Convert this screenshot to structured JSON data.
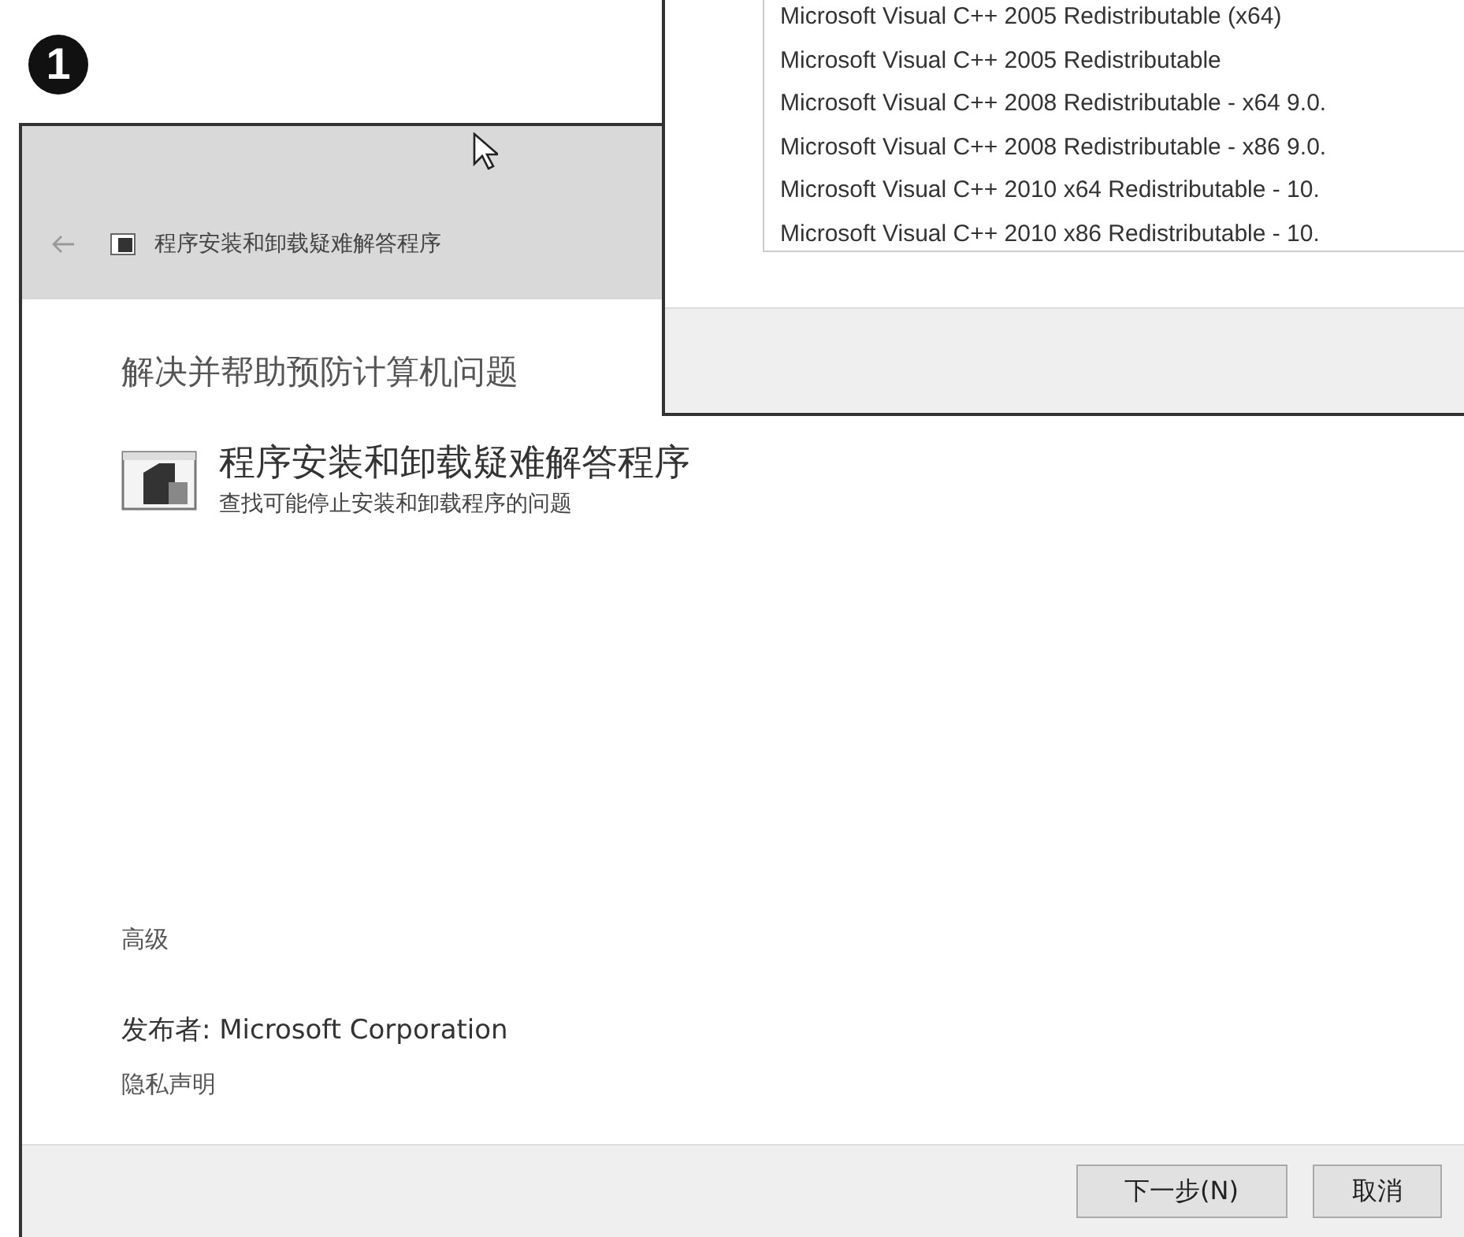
{
  "step_marker": "1",
  "dialog": {
    "title": "程序安装和卸载疑难解答程序",
    "heading": "解决并帮助预防计算机问题",
    "troubleshooter": {
      "title": "程序安装和卸载疑难解答程序",
      "description": "查找可能停止安装和卸载程序的问题"
    },
    "advanced": "高级",
    "publisher": "发布者: Microsoft Corporation",
    "privacy": "隐私声明",
    "buttons": [
      "下一步(N)",
      "取消"
    ]
  },
  "back_window": {
    "list_items": [
      "Microsoft Visual C++ 2005 Redistributable (x64)",
      "Microsoft Visual C++ 2005 Redistributable",
      "Microsoft Visual C++ 2008 Redistributable - x64 9.0.",
      "Microsoft Visual C++ 2008 Redistributable - x86 9.0.",
      "Microsoft Visual C++ 2010  x64 Redistributable - 10.",
      "Microsoft Visual C++ 2010  x86 Redistributable - 10."
    ]
  }
}
